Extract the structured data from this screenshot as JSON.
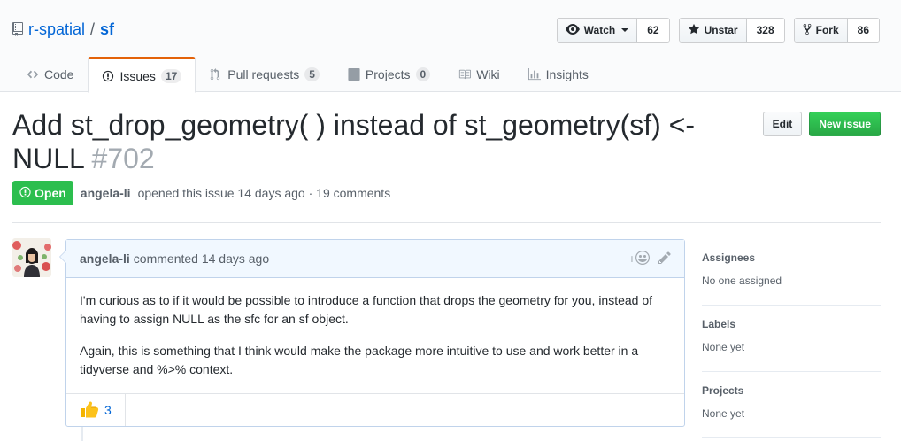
{
  "repo": {
    "owner": "r-spatial",
    "separator": "/",
    "name": "sf"
  },
  "actions": {
    "watch_label": "Watch",
    "watch_count": "62",
    "star_label": "Unstar",
    "star_count": "328",
    "fork_label": "Fork",
    "fork_count": "86"
  },
  "tabs": [
    {
      "label": "Code",
      "count": null,
      "selected": false
    },
    {
      "label": "Issues",
      "count": "17",
      "selected": true
    },
    {
      "label": "Pull requests",
      "count": "5",
      "selected": false
    },
    {
      "label": "Projects",
      "count": "0",
      "selected": false
    },
    {
      "label": "Wiki",
      "count": null,
      "selected": false
    },
    {
      "label": "Insights",
      "count": null,
      "selected": false
    }
  ],
  "issue": {
    "title": "Add st_drop_geometry( ) instead of st_geometry(sf) <- NULL",
    "number": "#702",
    "state": "Open",
    "author": "angela-li",
    "meta_text": "opened this issue 14 days ago · 19 comments",
    "edit_label": "Edit",
    "new_issue_label": "New issue"
  },
  "comment": {
    "author": "angela-li",
    "action_text": "commented 14 days ago",
    "paragraphs": [
      "I'm curious as to if it would be possible to introduce a function that drops the geometry for you, instead of having to assign NULL as the sfc for an sf object.",
      "Again, this is something that I think would make the package more intuitive to use and work better in a tidyverse and %>% context."
    ],
    "reaction_count": "3",
    "add_reaction_symbol": "+"
  },
  "sidebar": {
    "assignees": {
      "heading": "Assignees",
      "value": "No one assigned"
    },
    "labels": {
      "heading": "Labels",
      "value": "None yet"
    },
    "projects": {
      "heading": "Projects",
      "value": "None yet"
    }
  },
  "colors": {
    "open_green": "#2cbe4e",
    "link_blue": "#0366d6",
    "tab_accent": "#e36209",
    "new_issue_green": "#28a745"
  }
}
